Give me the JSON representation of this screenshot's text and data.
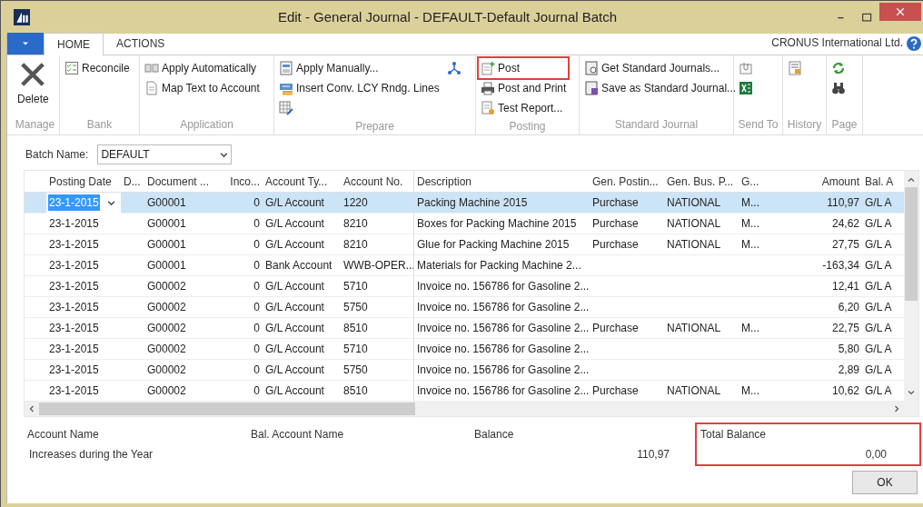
{
  "window": {
    "title": "Edit - General Journal - DEFAULT-Default Journal Batch"
  },
  "tabs": [
    {
      "label": "HOME",
      "selected": true
    },
    {
      "label": "ACTIONS",
      "selected": false
    }
  ],
  "company": "CRONUS International Ltd.",
  "ribbon_groups": [
    {
      "label": "Manage",
      "items": [
        {
          "kind": "large",
          "label": "Delete"
        }
      ]
    },
    {
      "label": "Bank",
      "items": [
        {
          "kind": "small",
          "label": "Reconcile"
        }
      ]
    },
    {
      "label": "Application",
      "items": [
        {
          "kind": "small",
          "label": "Apply Automatically"
        },
        {
          "kind": "small",
          "label": "Map Text to Account"
        }
      ]
    },
    {
      "label": "Prepare",
      "items": [
        {
          "kind": "small",
          "label": "Apply Manually..."
        },
        {
          "kind": "small",
          "label": "Insert Conv. LCY Rndg. Lines"
        },
        {
          "kind": "icon"
        },
        {
          "kind": "icon"
        }
      ]
    },
    {
      "label": "Posting",
      "items": [
        {
          "kind": "small",
          "label": "Post",
          "highlighted": true
        },
        {
          "kind": "small",
          "label": "Post and Print",
          "highlighted": false
        },
        {
          "kind": "small",
          "label": "Test Report...",
          "highlighted": false
        }
      ]
    },
    {
      "label": "Standard Journal",
      "items": [
        {
          "kind": "small",
          "label": "Get Standard Journals..."
        },
        {
          "kind": "small",
          "label": "Save as Standard Journal..."
        }
      ]
    },
    {
      "label": "Send To",
      "items": [
        {
          "kind": "icon"
        },
        {
          "kind": "icon"
        }
      ]
    },
    {
      "label": "History",
      "items": [
        {
          "kind": "icon"
        }
      ]
    },
    {
      "label": "Page",
      "items": [
        {
          "kind": "icon"
        },
        {
          "kind": "icon"
        }
      ]
    }
  ],
  "batch": {
    "label": "Batch Name:",
    "value": "DEFAULT"
  },
  "table": {
    "columns": [
      "Posting Date",
      "D...",
      "Document ...",
      "Inco...",
      "Account Ty...",
      "Account No.",
      "Description",
      "Gen. Postin...",
      "Gen. Bus. P...",
      "G...",
      "Amount",
      "Bal. A"
    ],
    "rows": [
      {
        "selected": true,
        "cells": [
          "23-1-2015",
          "",
          "G00001",
          "0",
          "G/L Account",
          "1220",
          "Packing Machine 2015",
          "Purchase",
          "NATIONAL",
          "M...",
          "110,97",
          "G/L A"
        ]
      },
      {
        "selected": false,
        "cells": [
          "23-1-2015",
          "",
          "G00001",
          "0",
          "G/L Account",
          "8210",
          "Boxes for Packing Machine 2015",
          "Purchase",
          "NATIONAL",
          "M...",
          "24,62",
          "G/L A"
        ]
      },
      {
        "selected": false,
        "cells": [
          "23-1-2015",
          "",
          "G00001",
          "0",
          "G/L Account",
          "8210",
          "Glue for Packing Machine 2015",
          "Purchase",
          "NATIONAL",
          "M...",
          "27,75",
          "G/L A"
        ]
      },
      {
        "selected": false,
        "cells": [
          "23-1-2015",
          "",
          "G00001",
          "0",
          "Bank Account",
          "WWB-OPER...",
          "Materials for Packing Machine 2...",
          "",
          "",
          "",
          "-163,34",
          "G/L A"
        ]
      },
      {
        "selected": false,
        "cells": [
          "23-1-2015",
          "",
          "G00002",
          "0",
          "G/L Account",
          "5710",
          "Invoice no. 156786 for Gasoline 2...",
          "",
          "",
          "",
          "12,41",
          "G/L A"
        ]
      },
      {
        "selected": false,
        "cells": [
          "23-1-2015",
          "",
          "G00002",
          "0",
          "G/L Account",
          "5750",
          "Invoice no. 156786 for Gasoline 2...",
          "",
          "",
          "",
          "6,20",
          "G/L A"
        ]
      },
      {
        "selected": false,
        "cells": [
          "23-1-2015",
          "",
          "G00002",
          "0",
          "G/L Account",
          "8510",
          "Invoice no. 156786 for Gasoline 2...",
          "Purchase",
          "NATIONAL",
          "M...",
          "22,75",
          "G/L A"
        ]
      },
      {
        "selected": false,
        "cells": [
          "23-1-2015",
          "",
          "G00002",
          "0",
          "G/L Account",
          "5710",
          "Invoice no. 156786 for Gasoline 2...",
          "",
          "",
          "",
          "5,80",
          "G/L A"
        ]
      },
      {
        "selected": false,
        "cells": [
          "23-1-2015",
          "",
          "G00002",
          "0",
          "G/L Account",
          "5750",
          "Invoice no. 156786 for Gasoline 2...",
          "",
          "",
          "",
          "2,89",
          "G/L A"
        ]
      },
      {
        "selected": false,
        "cells": [
          "23-1-2015",
          "",
          "G00002",
          "0",
          "G/L Account",
          "8510",
          "Invoice no. 156786 for Gasoline 2...",
          "Purchase",
          "NATIONAL",
          "M...",
          "10,62",
          "G/L A"
        ]
      }
    ]
  },
  "footer": [
    {
      "label": "Account Name",
      "value": "Increases during the Year"
    },
    {
      "label": "Bal. Account Name"
    },
    {
      "label": "Balance",
      "value": "110,97"
    },
    {
      "label": "Total Balance",
      "value": "0,00",
      "highlighted": true
    }
  ],
  "buttons": [
    "OK"
  ]
}
